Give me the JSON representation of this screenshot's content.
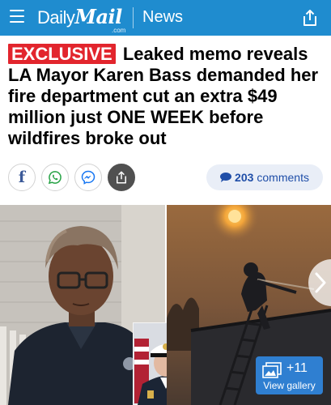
{
  "header": {
    "logo_daily": "Daily",
    "logo_mail": "Mail",
    "logo_com": ".com",
    "section": "News",
    "bar_color": "#1f8ccf"
  },
  "article": {
    "tag": "EXCLUSIVE",
    "headline": "Leaked memo reveals LA Mayor Karen Bass demanded her fire department cut an extra $49 million just ONE WEEK before wildfires broke out",
    "tag_color": "#e2252d"
  },
  "social": {
    "icons": [
      "facebook-icon",
      "whatsapp-icon",
      "messenger-icon",
      "share-icon"
    ]
  },
  "comments": {
    "count": "203",
    "label": "comments"
  },
  "gallery": {
    "count": "+11",
    "label": "View gallery"
  }
}
